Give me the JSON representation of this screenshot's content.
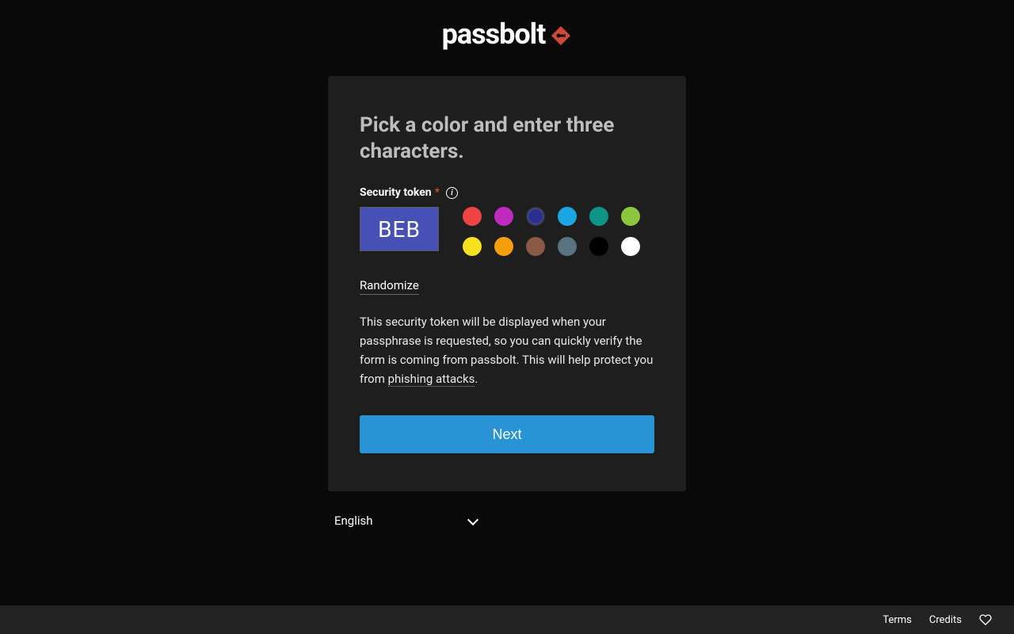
{
  "logo": {
    "text": "passbolt"
  },
  "card": {
    "title": "Pick a color and enter three characters.",
    "field_label": "Security token",
    "token_value": "BEB",
    "token_bg": "#4650b5",
    "colors": [
      {
        "hex": "#ef4444",
        "name": "red",
        "selected": false
      },
      {
        "hex": "#bd2cbf",
        "name": "purple",
        "selected": false
      },
      {
        "hex": "#2c2f8f",
        "name": "indigo",
        "selected": true
      },
      {
        "hex": "#1ba7e3",
        "name": "blue",
        "selected": false
      },
      {
        "hex": "#0f9488",
        "name": "teal",
        "selected": false
      },
      {
        "hex": "#8cc63f",
        "name": "green",
        "selected": false
      },
      {
        "hex": "#f7e01e",
        "name": "yellow",
        "selected": false
      },
      {
        "hex": "#f59e0b",
        "name": "orange",
        "selected": false
      },
      {
        "hex": "#8a5a44",
        "name": "brown",
        "selected": false
      },
      {
        "hex": "#5a7380",
        "name": "slate",
        "selected": false
      },
      {
        "hex": "#000000",
        "name": "black",
        "selected": false
      },
      {
        "hex": "#ffffff",
        "name": "white",
        "selected": false
      }
    ],
    "randomize_label": "Randomize",
    "description_pre": "This security token will be displayed when your passphrase is requested, so you can quickly verify the form is coming from passbolt. This will help protect you from ",
    "description_link": "phishing attacks",
    "description_post": ".",
    "next_label": "Next"
  },
  "lang": {
    "selected": "English"
  },
  "footer": {
    "terms": "Terms",
    "credits": "Credits"
  }
}
